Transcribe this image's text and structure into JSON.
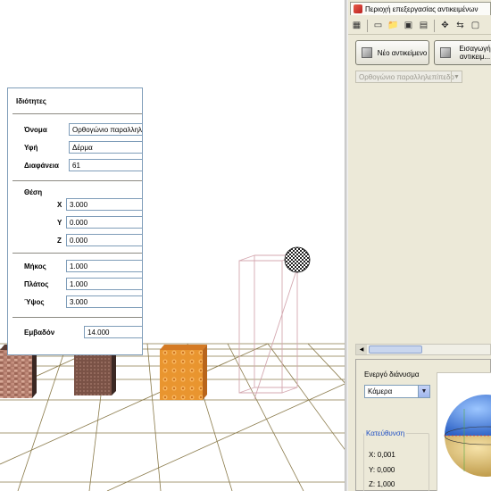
{
  "panel": {
    "tab_title": "Περιοχή επεξεργασίας αντικειμένων",
    "toolbar_icons": [
      "grid-icon",
      "new-file-icon",
      "open-folder-icon",
      "save-icon",
      "save-as-icon",
      "move-icon",
      "rotate-icon",
      "view-icon"
    ],
    "new_object_label": "Νέο αντικείμενο",
    "import_object_label": "Εισαγωγή αντικειμ...",
    "shape_select": "Ορθογώνιο παραλληλεπίπεδο",
    "properties": {
      "title": "Ιδιότητες",
      "name_label": "Όνομα",
      "name_value": "Ορθογώνιο παραλληλ...",
      "texture_label": "Υφή",
      "texture_value": "Δέρμα",
      "transparency_label": "Διαφάνεια",
      "transparency_value": "61",
      "position_label": "Θέση",
      "x_label": "X",
      "x_value": "3.000",
      "y_label": "Y",
      "y_value": "0.000",
      "z_label": "Z",
      "z_value": "0.000",
      "length_label": "Μήκος",
      "length_value": "1.000",
      "width_label": "Πλάτος",
      "width_value": "1.000",
      "height_label": "Ύψος",
      "height_value": "3.000",
      "area_label": "Εμβαδόν",
      "area_value": "14.000"
    },
    "vector": {
      "title": "Ενεργό διάνυσμα",
      "select_value": "Κάμερα",
      "direction_title": "Κατεύθυνση",
      "x_text": "X: 0,001",
      "y_text": "Y: 0,000",
      "z_text": "Z: 1,000"
    }
  },
  "colors": {
    "grid": "#8a7a4a",
    "brick_cube": "#9b6a5a",
    "mesh_cube": "#7a5246",
    "orange_cube": "#e08a2a",
    "wire_box": "#d4a8b0",
    "sphere_blue": "#3f7fe0",
    "sphere_yellow": "#e0c068"
  }
}
